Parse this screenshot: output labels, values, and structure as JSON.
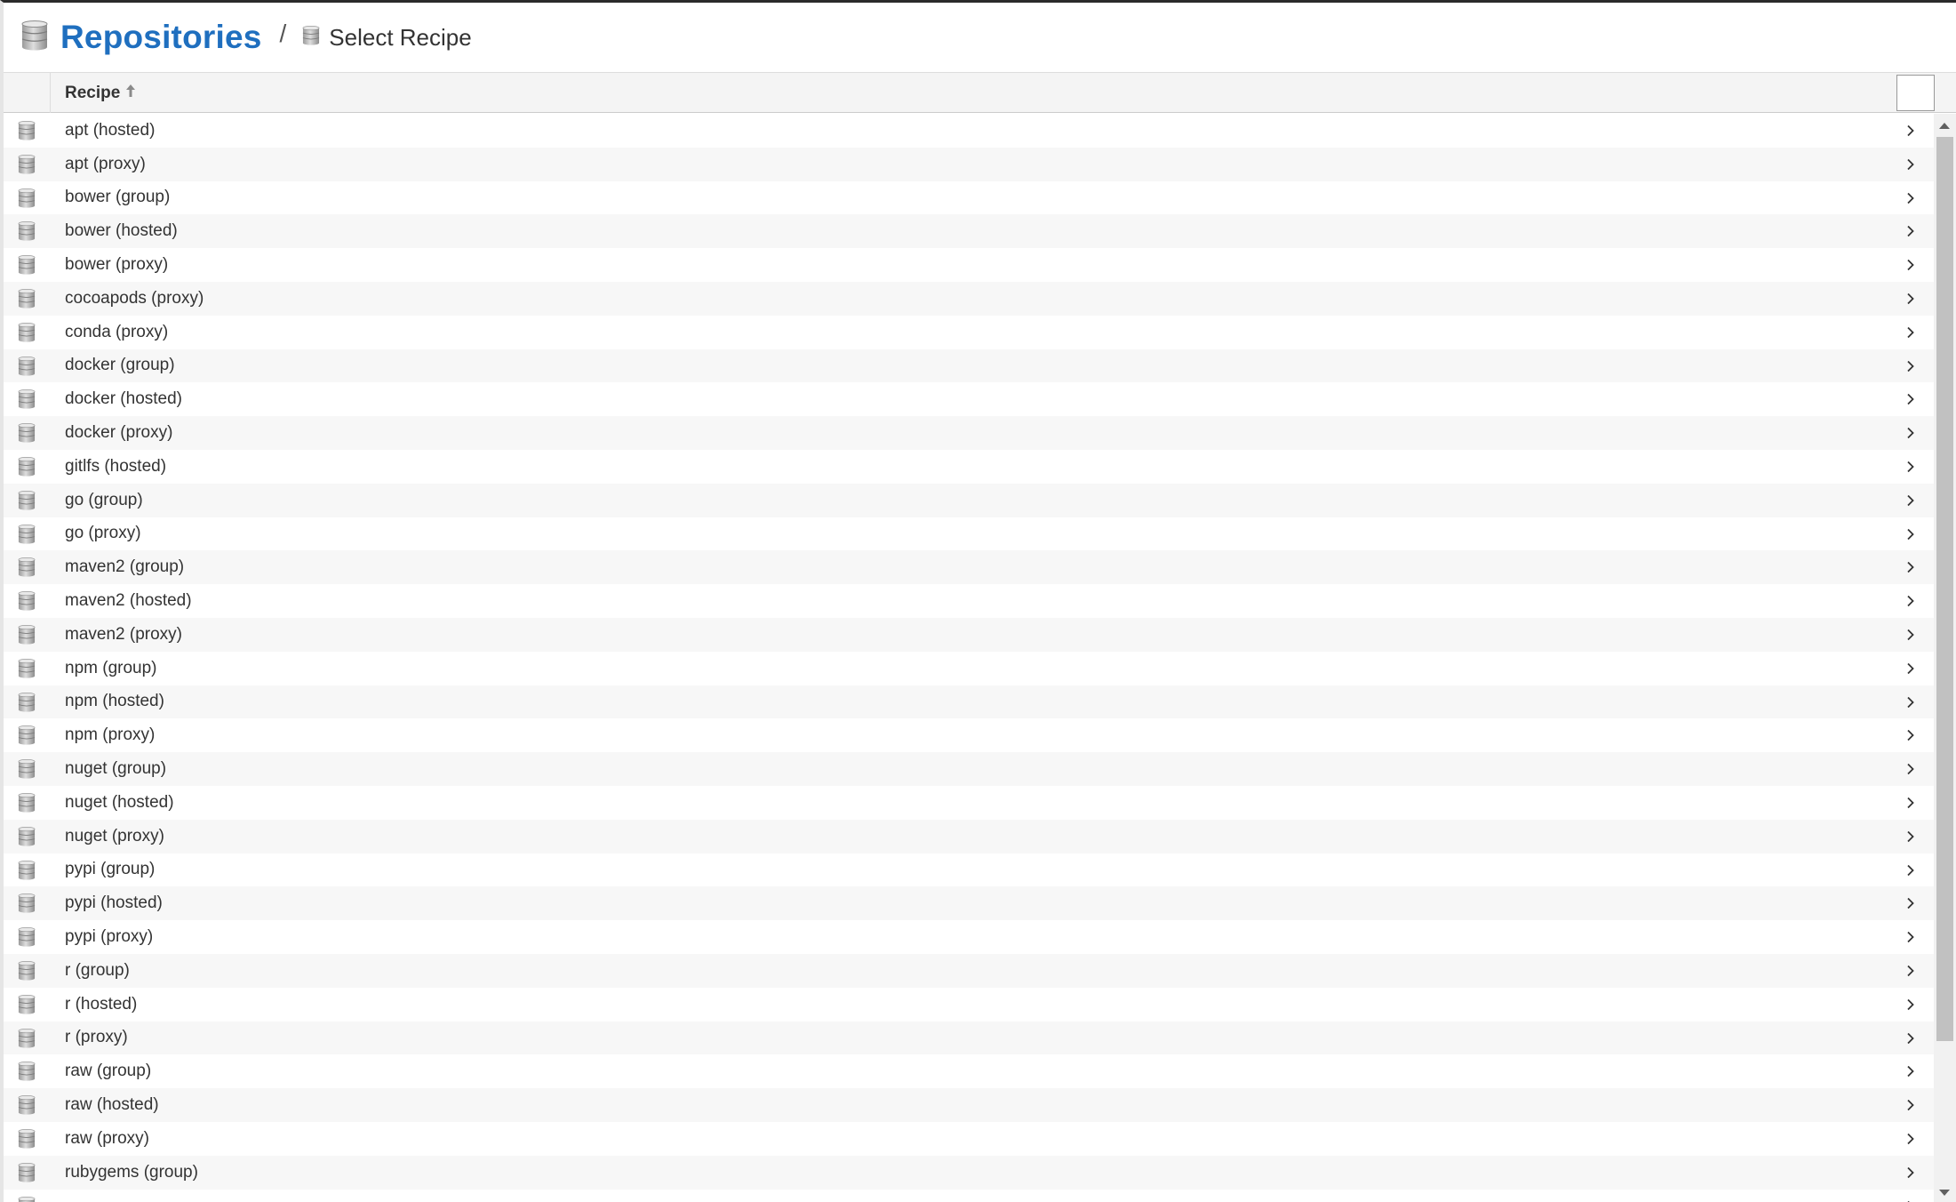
{
  "header": {
    "title": "Repositories",
    "separator": "/",
    "subtitle": "Select Recipe"
  },
  "table": {
    "column_header": "Recipe",
    "sort": "ascending"
  },
  "rows": [
    "apt (hosted)",
    "apt (proxy)",
    "bower (group)",
    "bower (hosted)",
    "bower (proxy)",
    "cocoapods (proxy)",
    "conda (proxy)",
    "docker (group)",
    "docker (hosted)",
    "docker (proxy)",
    "gitlfs (hosted)",
    "go (group)",
    "go (proxy)",
    "maven2 (group)",
    "maven2 (hosted)",
    "maven2 (proxy)",
    "npm (group)",
    "npm (hosted)",
    "npm (proxy)",
    "nuget (group)",
    "nuget (hosted)",
    "nuget (proxy)",
    "pypi (group)",
    "pypi (hosted)",
    "pypi (proxy)",
    "r (group)",
    "r (hosted)",
    "r (proxy)",
    "raw (group)",
    "raw (hosted)",
    "raw (proxy)",
    "rubygems (group)",
    ""
  ],
  "icons": {
    "header": "database-icon",
    "subtitle": "database-icon",
    "row": "database-icon",
    "row_action": "chevron-right-icon",
    "sort": "arrow-up-icon"
  },
  "colors": {
    "title": "#1f6fbf",
    "selected_marker": "#2eb872"
  }
}
